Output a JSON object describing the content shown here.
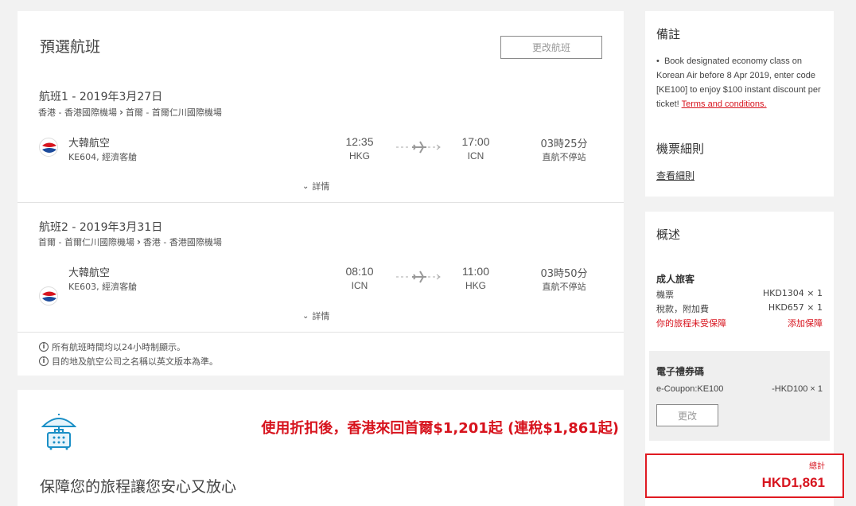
{
  "flights": {
    "title": "預選航班",
    "change_button": "更改航班",
    "items": [
      {
        "date": "航班1 - 2019年3月27日",
        "from": "香港 - 香港國際機場",
        "to": "首爾 - 首爾仁川國際機場",
        "airline": "大韓航空",
        "flight_no": "KE604, 經濟客艙",
        "dep_time": "12:35",
        "dep_code": "HKG",
        "arr_time": "17:00",
        "arr_code": "ICN",
        "duration": "03時25分",
        "stops": "直航不停站",
        "details": "詳情"
      },
      {
        "date": "航班2 - 2019年3月31日",
        "from": "首爾 - 首爾仁川國際機場",
        "to": "香港 - 香港國際機場",
        "airline": "大韓航空",
        "flight_no": "KE603, 經濟客艙",
        "dep_time": "08:10",
        "dep_code": "ICN",
        "arr_time": "11:00",
        "arr_code": "HKG",
        "duration": "03時50分",
        "stops": "直航不停站",
        "details": "詳情"
      }
    ],
    "notes": [
      "所有航班時間均以24小時制顯示。",
      "目的地及航空公司之名稱以英文版本為準。"
    ]
  },
  "insurance": {
    "promo": "使用折扣後，香港來回首爾$1,201起 (連稅$1,861起)",
    "title": "保障您的旅程讓您安心又放心"
  },
  "remarks": {
    "title": "備註",
    "text": "Book designated economy class on Korean Air before 8 Apr 2019, enter code [KE100] to enjoy $100 instant discount per ticket!",
    "terms_link": "Terms and conditions.",
    "ticket_rules_title": "機票細則",
    "ticket_rules_link": "查看細則"
  },
  "summary": {
    "title": "概述",
    "passenger_type": "成人旅客",
    "fare_label": "機票",
    "fare_value": "HKD1304 × 1",
    "tax_label": "稅款，附加費",
    "tax_value": "HKD657 × 1",
    "unprotected": "你的旅程未受保障",
    "add_protection": "添加保障",
    "coupon_title": "電子禮券碼",
    "coupon_label": "e-Coupon:KE100",
    "coupon_value": "-HKD100 × 1",
    "change_button": "更改",
    "total_label": "總計",
    "total_value": "HKD1,861"
  },
  "colors": {
    "accent_red": "#d7141e",
    "background": "#f2f2f2",
    "panel": "#ffffff"
  }
}
